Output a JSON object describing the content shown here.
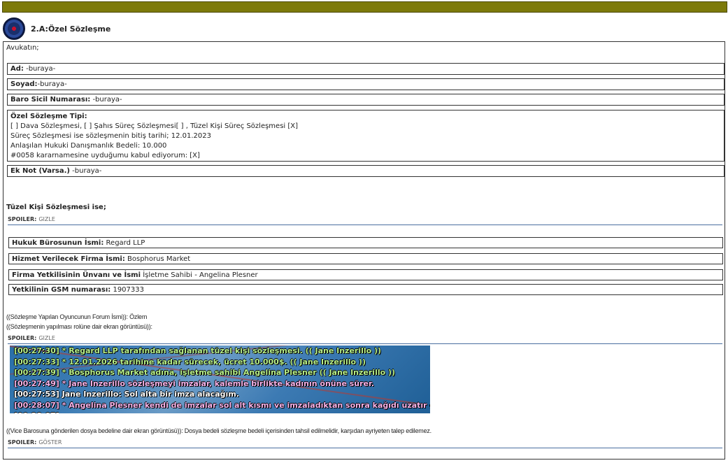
{
  "header": {
    "title": "2.A:Özel Sözleşme"
  },
  "intro": "Avukatın;",
  "fields": {
    "ad_label": "Ad:",
    "ad_value": " -buraya-",
    "soyad_label": "Soyad:",
    "soyad_value": "-buraya-",
    "baro_label": "Baro Sicil Numarası:",
    "baro_value": " -buraya-",
    "tip_label": "Özel Sözleşme Tipi:",
    "tip_line1": "[ ] Dava Sözleşmesi, [ ] Şahıs Süreç Sözleşmesi[ ] , Tüzel Kişi Süreç Sözleşmesi [X]",
    "tip_line2": "Süreç Sözleşmesi ise sözleşmenin bitiş tarihi; 12.01.2023",
    "tip_line3": "Anlaşılan Hukuki Danışmanlık Bedeli: 10.000",
    "tip_line4": "#0058 kararnamesine uyduğumu kabul ediyorum: [X]",
    "ek_label": "Ek Not (Varsa.)",
    "ek_value": " -buraya-"
  },
  "tuzel_heading": "Tüzel Kişi Sözleşmesi ise;",
  "spoiler1": {
    "label": "SPOILER:",
    "action": "GIZLE"
  },
  "firm": {
    "buro_label": "Hukuk Bürosunun İsmi:",
    "buro_value": " Regard LLP",
    "firma_label": "Hizmet Verilecek Firma İsmi:",
    "firma_value": " Bosphorus Market",
    "yetkili_label": "Firma Yetkilisinin Ünvanı ve İsmi",
    "yetkili_value": " İşletme Sahibi - Angelina Plesner",
    "gsm_label": "Yetkilinin GSM numarası:",
    "gsm_value": " 1907333"
  },
  "forum_line": "((Sözleşme Yapılan Oyuncunun Forum İsmi)): Özlem",
  "screenshot_line": "((Sözleşmenin yapılması rolüne dair ekran görüntüsü)):",
  "spoiler2": {
    "label": "SPOILER:",
    "action": "GIZLE"
  },
  "chat": [
    {
      "ts": "[00:27:30]",
      "text": " * Regard LLP tarafından sağlanan tüzel kişi sözleşmesi. (( Jane Inzerillo ))",
      "color": "green"
    },
    {
      "ts": "[00:27:33]",
      "text": " * 12.01.2026 tarihine kadar sürecek, ücret 10.000$. (( Jane Inzerillo ))",
      "color": "green"
    },
    {
      "ts": "[00:27:39]",
      "text": " * Bosphorus Market adına, işletme sahibi Angelina Plesner (( Jane Inzerillo ))",
      "color": "green"
    },
    {
      "ts": "[00:27:49]",
      "text": " * Jane Inzerillo sözleşmeyi imzalar, kalemle birlikte kadının önüne sürer.",
      "color": "pink"
    },
    {
      "ts": "[00:27:53]",
      "text": " Jane Inzerillo: Sol alta bir imza alacağım.",
      "color": "white"
    },
    {
      "ts": "[00:28:07]",
      "text": " * Angelina Plesner kendi de imzalar sol alt kısmı ve imzaladıktan sonra kağıdı uzatır geri....",
      "color": "pink"
    },
    {
      "ts": "[00:28:07]",
      "text": "",
      "color": "white"
    }
  ],
  "vice_line": "((Vice Barosuna gönderilen dosya bedeline dair ekran görüntüsü)): Dosya bedeli sözleşme bedeli içerisinden tahsil edilmelidir, karşıdan ayriyeten talep edilemez.",
  "spoiler3": {
    "label": "SPOILER:",
    "action": "GÖSTER"
  }
}
